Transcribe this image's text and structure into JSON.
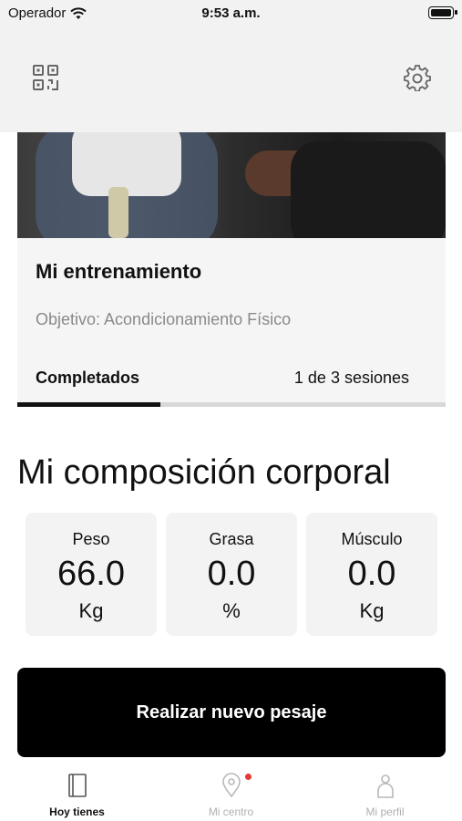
{
  "status_bar": {
    "carrier": "Operador",
    "time": "9:53 a.m."
  },
  "top_nav": {
    "left_icon": "qr-code-icon",
    "right_icon": "gear-icon"
  },
  "training_card": {
    "title": "Mi entrenamiento",
    "objective": "Objetivo: Acondicionamiento Físico",
    "completed_label": "Completados",
    "sessions_text": "1 de 3 sesiones",
    "progress_fraction": 0.3333
  },
  "body_composition": {
    "title": "Mi composición corporal",
    "metrics": [
      {
        "label": "Peso",
        "value": "66.0",
        "unit": "Kg"
      },
      {
        "label": "Grasa",
        "value": "0.0",
        "unit": "%"
      },
      {
        "label": "Músculo",
        "value": "0.0",
        "unit": "Kg"
      }
    ]
  },
  "cta": {
    "label": "Realizar nuevo pesaje"
  },
  "tab_bar": {
    "tabs": [
      {
        "label": "Hoy tienes",
        "icon": "book-icon",
        "active": true
      },
      {
        "label": "Mi centro",
        "icon": "location-pin-icon",
        "active": false,
        "badge": true
      },
      {
        "label": "Mi perfil",
        "icon": "person-icon",
        "active": false
      }
    ],
    "badge_color": "#e53935"
  }
}
